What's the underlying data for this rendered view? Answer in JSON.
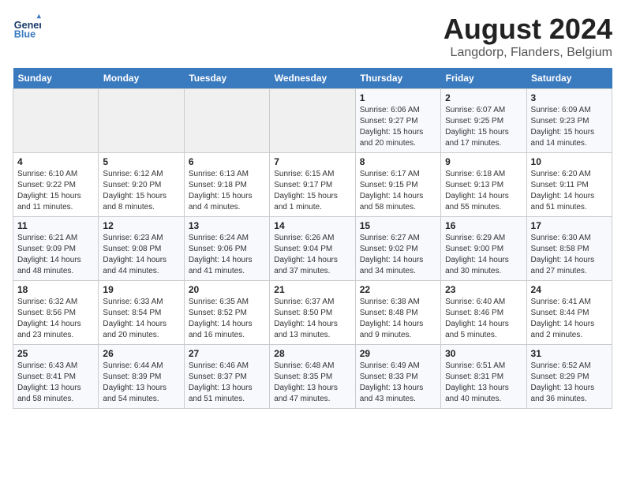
{
  "header": {
    "logo_line1": "General",
    "logo_line2": "Blue",
    "title": "August 2024",
    "subtitle": "Langdorp, Flanders, Belgium"
  },
  "weekdays": [
    "Sunday",
    "Monday",
    "Tuesday",
    "Wednesday",
    "Thursday",
    "Friday",
    "Saturday"
  ],
  "weeks": [
    [
      {
        "day": "",
        "empty": true
      },
      {
        "day": "",
        "empty": true
      },
      {
        "day": "",
        "empty": true
      },
      {
        "day": "",
        "empty": true
      },
      {
        "day": "1",
        "info": "Sunrise: 6:06 AM\nSunset: 9:27 PM\nDaylight: 15 hours\nand 20 minutes."
      },
      {
        "day": "2",
        "info": "Sunrise: 6:07 AM\nSunset: 9:25 PM\nDaylight: 15 hours\nand 17 minutes."
      },
      {
        "day": "3",
        "info": "Sunrise: 6:09 AM\nSunset: 9:23 PM\nDaylight: 15 hours\nand 14 minutes."
      }
    ],
    [
      {
        "day": "4",
        "info": "Sunrise: 6:10 AM\nSunset: 9:22 PM\nDaylight: 15 hours\nand 11 minutes."
      },
      {
        "day": "5",
        "info": "Sunrise: 6:12 AM\nSunset: 9:20 PM\nDaylight: 15 hours\nand 8 minutes."
      },
      {
        "day": "6",
        "info": "Sunrise: 6:13 AM\nSunset: 9:18 PM\nDaylight: 15 hours\nand 4 minutes."
      },
      {
        "day": "7",
        "info": "Sunrise: 6:15 AM\nSunset: 9:17 PM\nDaylight: 15 hours\nand 1 minute."
      },
      {
        "day": "8",
        "info": "Sunrise: 6:17 AM\nSunset: 9:15 PM\nDaylight: 14 hours\nand 58 minutes."
      },
      {
        "day": "9",
        "info": "Sunrise: 6:18 AM\nSunset: 9:13 PM\nDaylight: 14 hours\nand 55 minutes."
      },
      {
        "day": "10",
        "info": "Sunrise: 6:20 AM\nSunset: 9:11 PM\nDaylight: 14 hours\nand 51 minutes."
      }
    ],
    [
      {
        "day": "11",
        "info": "Sunrise: 6:21 AM\nSunset: 9:09 PM\nDaylight: 14 hours\nand 48 minutes."
      },
      {
        "day": "12",
        "info": "Sunrise: 6:23 AM\nSunset: 9:08 PM\nDaylight: 14 hours\nand 44 minutes."
      },
      {
        "day": "13",
        "info": "Sunrise: 6:24 AM\nSunset: 9:06 PM\nDaylight: 14 hours\nand 41 minutes."
      },
      {
        "day": "14",
        "info": "Sunrise: 6:26 AM\nSunset: 9:04 PM\nDaylight: 14 hours\nand 37 minutes."
      },
      {
        "day": "15",
        "info": "Sunrise: 6:27 AM\nSunset: 9:02 PM\nDaylight: 14 hours\nand 34 minutes."
      },
      {
        "day": "16",
        "info": "Sunrise: 6:29 AM\nSunset: 9:00 PM\nDaylight: 14 hours\nand 30 minutes."
      },
      {
        "day": "17",
        "info": "Sunrise: 6:30 AM\nSunset: 8:58 PM\nDaylight: 14 hours\nand 27 minutes."
      }
    ],
    [
      {
        "day": "18",
        "info": "Sunrise: 6:32 AM\nSunset: 8:56 PM\nDaylight: 14 hours\nand 23 minutes."
      },
      {
        "day": "19",
        "info": "Sunrise: 6:33 AM\nSunset: 8:54 PM\nDaylight: 14 hours\nand 20 minutes."
      },
      {
        "day": "20",
        "info": "Sunrise: 6:35 AM\nSunset: 8:52 PM\nDaylight: 14 hours\nand 16 minutes."
      },
      {
        "day": "21",
        "info": "Sunrise: 6:37 AM\nSunset: 8:50 PM\nDaylight: 14 hours\nand 13 minutes."
      },
      {
        "day": "22",
        "info": "Sunrise: 6:38 AM\nSunset: 8:48 PM\nDaylight: 14 hours\nand 9 minutes."
      },
      {
        "day": "23",
        "info": "Sunrise: 6:40 AM\nSunset: 8:46 PM\nDaylight: 14 hours\nand 5 minutes."
      },
      {
        "day": "24",
        "info": "Sunrise: 6:41 AM\nSunset: 8:44 PM\nDaylight: 14 hours\nand 2 minutes."
      }
    ],
    [
      {
        "day": "25",
        "info": "Sunrise: 6:43 AM\nSunset: 8:41 PM\nDaylight: 13 hours\nand 58 minutes."
      },
      {
        "day": "26",
        "info": "Sunrise: 6:44 AM\nSunset: 8:39 PM\nDaylight: 13 hours\nand 54 minutes."
      },
      {
        "day": "27",
        "info": "Sunrise: 6:46 AM\nSunset: 8:37 PM\nDaylight: 13 hours\nand 51 minutes."
      },
      {
        "day": "28",
        "info": "Sunrise: 6:48 AM\nSunset: 8:35 PM\nDaylight: 13 hours\nand 47 minutes."
      },
      {
        "day": "29",
        "info": "Sunrise: 6:49 AM\nSunset: 8:33 PM\nDaylight: 13 hours\nand 43 minutes."
      },
      {
        "day": "30",
        "info": "Sunrise: 6:51 AM\nSunset: 8:31 PM\nDaylight: 13 hours\nand 40 minutes."
      },
      {
        "day": "31",
        "info": "Sunrise: 6:52 AM\nSunset: 8:29 PM\nDaylight: 13 hours\nand 36 minutes."
      }
    ]
  ]
}
